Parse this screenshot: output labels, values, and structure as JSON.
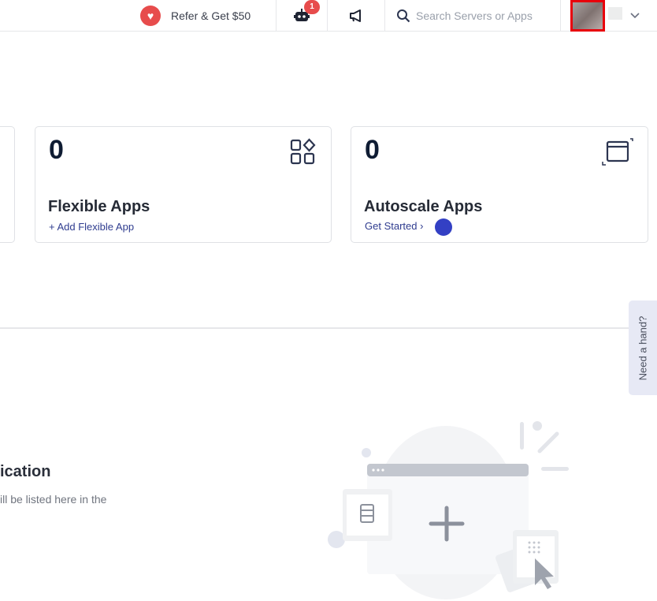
{
  "topbar": {
    "refer_label": "Refer & Get $50",
    "bot_badge": "1",
    "search_placeholder": "Search Servers or Apps"
  },
  "cards": [
    {
      "count": "0",
      "title": "Flexible Apps",
      "link": "+ Add Flexible App",
      "icon": "apps-grid-icon"
    },
    {
      "count": "0",
      "title": "Autoscale Apps",
      "link": "Get Started ›",
      "icon": "window-expand-icon"
    }
  ],
  "help": {
    "label": "Need a hand?"
  },
  "empty": {
    "title": "ication",
    "description": "ill be listed here in the"
  },
  "colors": {
    "accent": "#2f3c8f",
    "badge": "#e74c4c",
    "highlight": "#3340c4"
  }
}
